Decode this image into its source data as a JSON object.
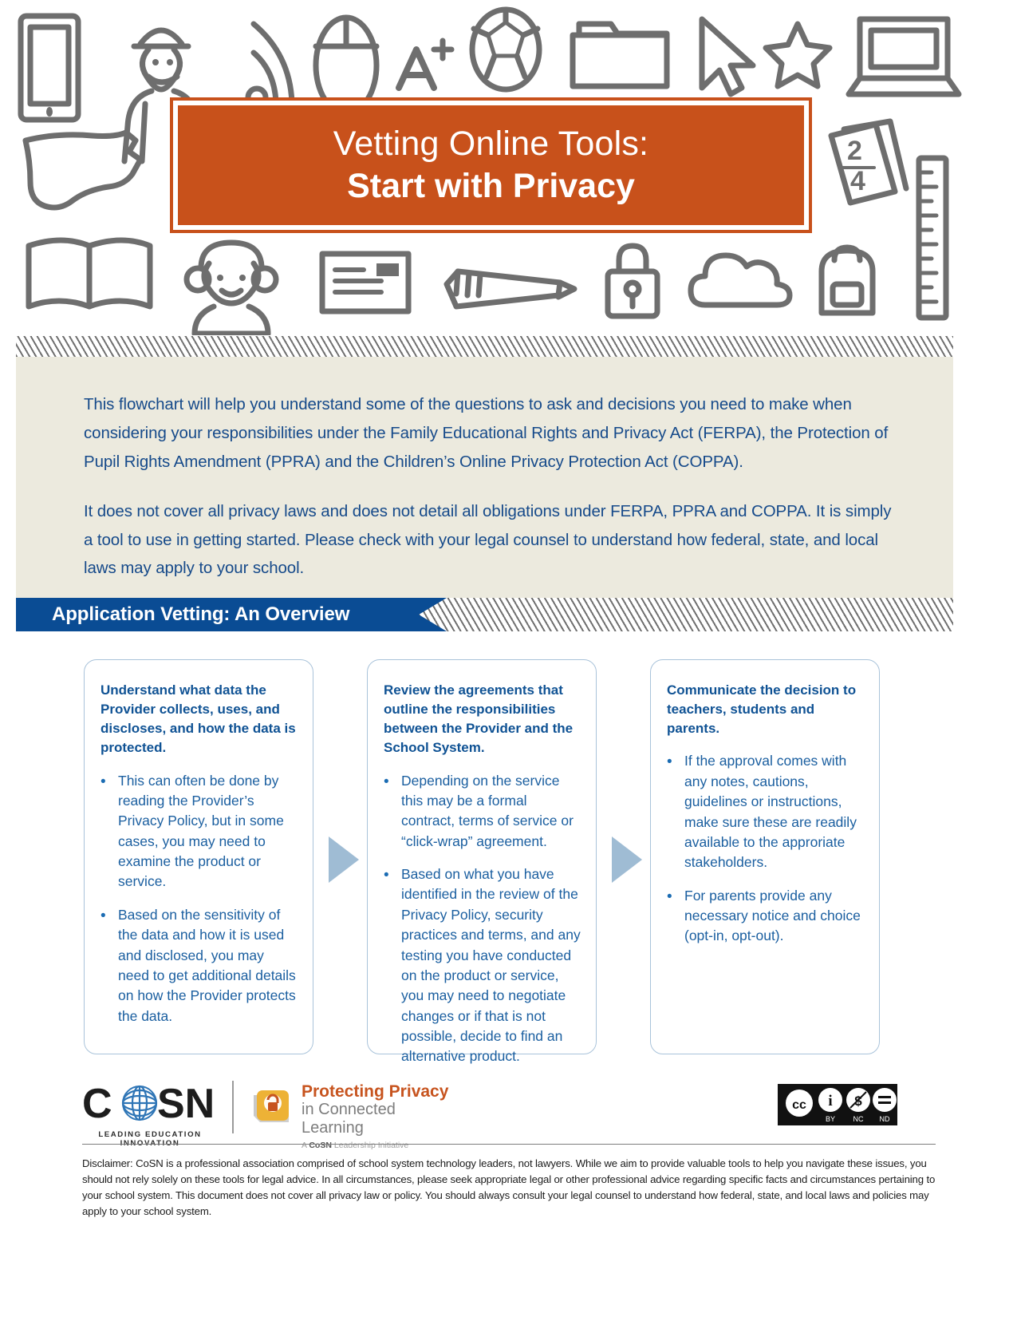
{
  "header": {
    "icons": [
      "tablet-icon",
      "teacher-icon",
      "wifi-icon",
      "mouse-icon",
      "a-plus-icon",
      "soccer-ball-icon",
      "folder-icon",
      "cursor-arrow-icon",
      "star-icon",
      "laptop-icon",
      "usa-map-icon",
      "flashcards-icon",
      "ruler-icon",
      "open-book-icon",
      "student-girl-icon",
      "envelope-icon",
      "pencil-icon",
      "padlock-icon",
      "cloud-icon",
      "backpack-icon"
    ],
    "title_line1": "Vetting Online Tools:",
    "title_line2": "Start with Privacy",
    "accent_color": "#c8511b"
  },
  "intro": {
    "paragraphs": [
      "This flowchart will help you understand some of the questions to ask and decisions you need to make when considering your responsibilities under the Family Educational Rights and Privacy Act (FERPA), the Protection of Pupil Rights Amendment (PPRA) and the Children’s Online Privacy Protection Act (COPPA).",
      "It does not cover all privacy laws and does not detail all obligations under FERPA, PPRA and COPPA. It is simply a tool to use in getting started.  Please check with your legal counsel to understand how federal, state, and local laws may apply to your school."
    ],
    "background_color": "#eceade",
    "text_color": "#164a8a"
  },
  "section": {
    "title": "Application Vetting: An Overview",
    "bar_color": "#0a4c94"
  },
  "cards": [
    {
      "name": "understand-data",
      "title": "Understand what data the Provider collects, uses, and discloses, and how the data is protected.",
      "bullets": [
        "This can often be done by reading the Provider’s Privacy Policy, but in some cases, you may need to examine the product or service.",
        "Based on the sensitivity of the data and how it is used and disclosed, you may need to get additional details on how the Provider protects the data."
      ]
    },
    {
      "name": "review-agreements",
      "title": "Review the agreements that outline the responsibilities between the Provider and the School System.",
      "bullets": [
        "Depending on the service this may be a formal contract, terms of service or “click-wrap” agreement.",
        "Based on what you have identified in the review of the Privacy Policy, security practices and terms, and any testing you have conducted on the product or service, you may need to negotiate changes or if that is not possible, decide to find an alternative product."
      ]
    },
    {
      "name": "communicate-decision",
      "title": "Communicate the decision to teachers, students and parents.",
      "bullets": [
        "If the approval comes with any notes, cautions, guidelines or instructions, make sure these are readily available to the approriate stakeholders.",
        "For parents provide any necessary notice and choice (opt-in, opt-out)."
      ]
    }
  ],
  "footer": {
    "cosn_name": "CoSN",
    "cosn_tagline": "LEADING EDUCATION INNOVATION",
    "pp_line1": "Protecting Privacy",
    "pp_line2": "in Connected Learning",
    "pp_line3_prefix": "A ",
    "pp_line3_brand": "CoSN",
    "pp_line3_suffix": " Leadership Initiative",
    "cc_labels": [
      "BY",
      "NC",
      "ND"
    ],
    "cc_mark": "cc",
    "disclaimer": "Disclaimer: CoSN is a professional association comprised of school system technology leaders, not lawyers. While we aim to provide valuable tools to help you navigate these issues, you should not rely solely on these tools for legal advice. In all circumstances, please seek appropriate legal or other professional advice regarding specific facts and circumstances pertaining to your school system. This document does not cover all privacy law or policy. You should always consult your legal counsel to understand how federal, state, and local laws and policies may apply to your school system."
  }
}
